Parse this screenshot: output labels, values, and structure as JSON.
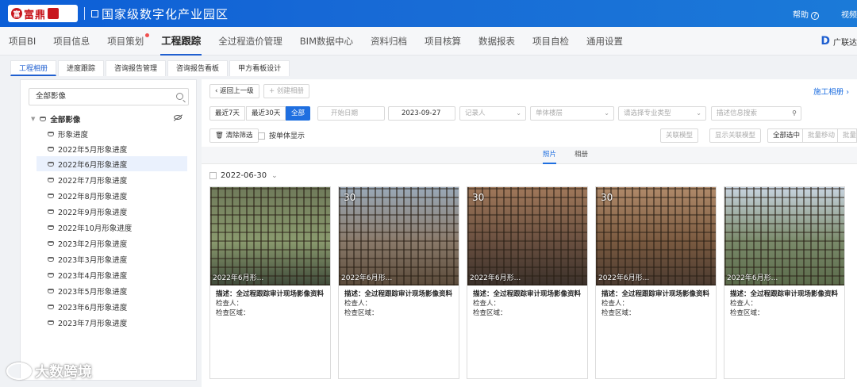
{
  "header": {
    "brand_text": "富鼎",
    "park_title": "国家级数字化产业园区",
    "help_label": "帮助",
    "right_cut_label": "视频"
  },
  "nav": {
    "items": [
      "项目BI",
      "项目信息",
      "项目策划",
      "工程跟踪",
      "全过程造价管理",
      "BIM数据中心",
      "资料归档",
      "项目核算",
      "数据报表",
      "项目自检",
      "通用设置"
    ],
    "active_index": 3,
    "dot_index": 2,
    "right_label": "广联达"
  },
  "subtabs": [
    "工程相册",
    "进度跟踪",
    "咨询报告管理",
    "咨询报告看板",
    "甲方看板设计"
  ],
  "tree": {
    "search_value": "全部影像",
    "root_label": "全部影像",
    "items": [
      "形象进度",
      "2022年5月形象进度",
      "2022年6月形象进度",
      "2022年7月形象进度",
      "2022年8月形象进度",
      "2022年9月形象进度",
      "2022年10月形象进度",
      "2023年2月形象进度",
      "2023年3月形象进度",
      "2023年4月形象进度",
      "2023年5月形象进度",
      "2023年6月形象进度",
      "2023年7月形象进度"
    ],
    "selected_index": 2
  },
  "toolbar": {
    "back_label": "返回上一级",
    "create_album_label": "+ 创建相册",
    "top_right_link": "施工相册 ›",
    "range_buttons": [
      "最近7天",
      "最近30天",
      "全部"
    ],
    "start_date_placeholder": "开始日期",
    "end_date_value": "2023-09-27",
    "recorder_placeholder": "记录人",
    "unit_floor_placeholder": "单体楼层",
    "specialty_placeholder": "请选择专业类型",
    "desc_search_placeholder": "描述信息搜索",
    "clear_filter_label": "清除筛选",
    "by_unit_label": "按单体显示",
    "link_model_label": "关联模型",
    "show_link_model_label": "显示关联模型",
    "select_all_label": "全部选中",
    "batch_move_label": "批量移动",
    "batch_cut_label": "批量"
  },
  "view_tabs": [
    "照片",
    "相册"
  ],
  "date_group": "2022-06-30",
  "cards": [
    {
      "photo_label": "2022年6月形...",
      "num": "",
      "desc": "描述：全过程跟踪审计现场影像资料",
      "inspector": "检查人：",
      "area": "检查区域：",
      "palette": [
        "#6f7a5a",
        "#8a9a6e",
        "#3f4a3a"
      ]
    },
    {
      "photo_label": "2022年6月形...",
      "num": "30",
      "desc": "描述：全过程跟踪审计现场影像资料",
      "inspector": "检查人：",
      "area": "检查区域：",
      "palette": [
        "#9aa9b8",
        "#8a7a6a",
        "#5a4a3a"
      ]
    },
    {
      "photo_label": "2022年6月形...",
      "num": "30",
      "desc": "描述：全过程跟踪审计现场影像资料",
      "inspector": "检查人：",
      "area": "检查区域：",
      "palette": [
        "#a0785a",
        "#6a5040",
        "#3a302a"
      ]
    },
    {
      "photo_label": "2022年6月形...",
      "num": "30",
      "desc": "描述：全过程跟踪审计现场影像资料",
      "inspector": "检查人：",
      "area": "检查区域：",
      "palette": [
        "#b08a6a",
        "#7a5a40",
        "#4a3a30"
      ]
    },
    {
      "photo_label": "2022年6月形...",
      "num": "",
      "desc": "描述：全过程跟踪审计现场影像资料",
      "inspector": "检查人：",
      "area": "检查区域：",
      "palette": [
        "#c8d4e0",
        "#7a8a6a",
        "#5a6a4a"
      ]
    }
  ],
  "watermark": "大数跨境"
}
